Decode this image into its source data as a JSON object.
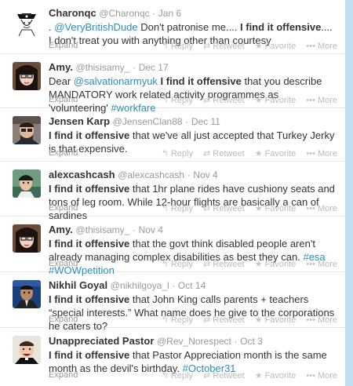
{
  "actions": {
    "expand": "Expand",
    "reply": "Reply",
    "retweet": "Retweet",
    "favorite": "Favorite",
    "more": "More"
  },
  "tweets": [
    {
      "fullname": "Charonqc",
      "username": "@Charonqc",
      "sep": "·",
      "time": "Jan 6",
      "text": [
        {
          "t": ". ",
          "s": "plain"
        },
        {
          "t": "@VeryBritishDude",
          "s": "link"
        },
        {
          "t": " Don't patronise me.... ",
          "s": "plain"
        },
        {
          "t": "I find it offensive",
          "s": "bold"
        },
        {
          "t": ".... I don't treat you with anything other than courtesy",
          "s": "plain"
        }
      ]
    },
    {
      "fullname": "Amy.",
      "username": "@thisisamy_",
      "sep": "·",
      "time": "Dec 17",
      "text": [
        {
          "t": "Dear ",
          "s": "plain"
        },
        {
          "t": "@salvationarmyuk",
          "s": "link"
        },
        {
          "t": " ",
          "s": "plain"
        },
        {
          "t": "I find it offensive",
          "s": "bold"
        },
        {
          "t": " that you describe MANDATORY work related activity programmes as 'volunteering' ",
          "s": "plain"
        },
        {
          "t": "#workfare",
          "s": "link"
        }
      ]
    },
    {
      "fullname": "Jensen Karp",
      "username": "@JensenClan88",
      "sep": "·",
      "time": "Dec 11",
      "text": [
        {
          "t": "I find it offensive",
          "s": "bold"
        },
        {
          "t": " that we've all just accepted that Turkey Jerky is that expensive.",
          "s": "plain"
        }
      ]
    },
    {
      "fullname": "alexcashcash",
      "username": "@alexcashcash",
      "sep": "·",
      "time": "Nov 4",
      "text": [
        {
          "t": "I find it offensive",
          "s": "bold"
        },
        {
          "t": " that 1hr plane rides have cushiony seats and tons of leg room. While 12-hour flights are basically a can of sardines",
          "s": "plain"
        }
      ]
    },
    {
      "fullname": "Amy.",
      "username": "@thisisamy_",
      "sep": "·",
      "time": "Nov 4",
      "text": [
        {
          "t": "I find it offensive",
          "s": "bold"
        },
        {
          "t": " that the govt think disabled people aren't already managing complex disabilities as best they can. ",
          "s": "plain"
        },
        {
          "t": "#esa",
          "s": "link"
        },
        {
          "t": " ",
          "s": "plain"
        },
        {
          "t": "#WOWpetition",
          "s": "link"
        }
      ]
    },
    {
      "fullname": "Nikhil Goyal",
      "username": "@nikhilgoya_l",
      "sep": "·",
      "time": "Oct 14",
      "text": [
        {
          "t": "I find it offensive",
          "s": "bold"
        },
        {
          "t": " that John King calls parents + teachers “special interests.” What name does he give to the corporations he caters to?",
          "s": "plain"
        }
      ]
    },
    {
      "fullname": "Unappreciated Pastor",
      "username": "@Rev_Norespect",
      "sep": "·",
      "time": "Oct 3",
      "text": [
        {
          "t": "I find it offensive",
          "s": "bold"
        },
        {
          "t": " that Pastor Appreciation month is the same month as the devil's birthday. ",
          "s": "plain"
        },
        {
          "t": "#October31",
          "s": "link"
        }
      ]
    }
  ]
}
